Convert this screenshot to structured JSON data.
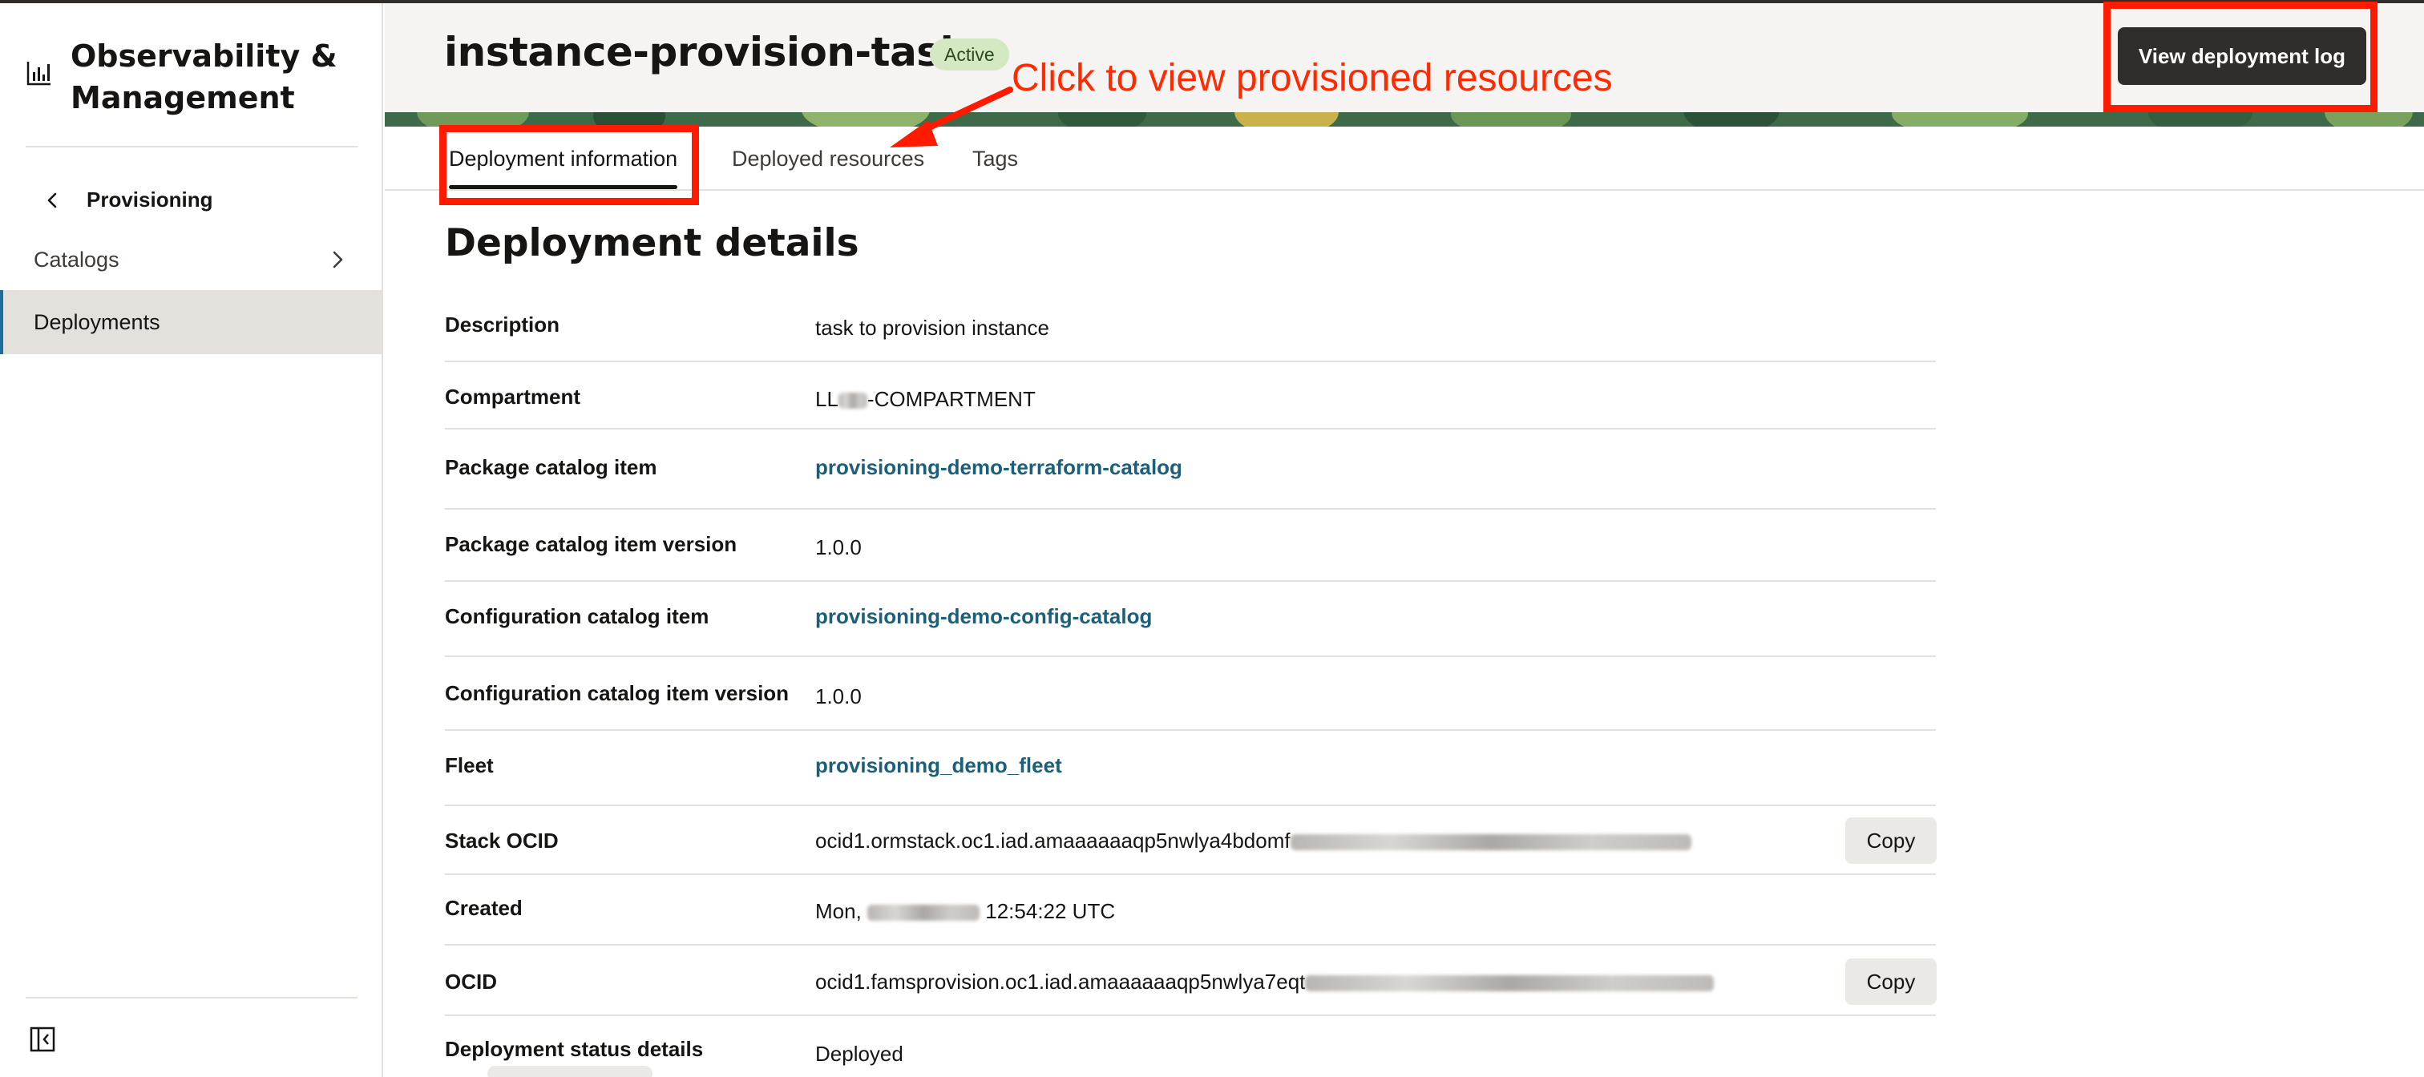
{
  "sidebar": {
    "title": "Observability & Management",
    "back_label": "Provisioning",
    "items": [
      {
        "label": "Catalogs"
      },
      {
        "label": "Deployments"
      }
    ]
  },
  "header": {
    "title": "instance-provision-task",
    "status": "Active",
    "primary_action": "View deployment log"
  },
  "annotation": {
    "text": "Click to view provisioned resources",
    "color": "#ff1a00"
  },
  "tabs": [
    {
      "label": "Deployment information",
      "active": true
    },
    {
      "label": "Deployed resources",
      "active": false
    },
    {
      "label": "Tags",
      "active": false
    }
  ],
  "details": {
    "title": "Deployment details",
    "rows": [
      {
        "label": "Description",
        "value": "task to provision instance"
      },
      {
        "label": "Compartment",
        "value_prefix": "LL",
        "value_suffix": "-COMPARTMENT"
      },
      {
        "label": "Package catalog item",
        "value": "provisioning-demo-terraform-catalog"
      },
      {
        "label": "Package catalog item version",
        "value": "1.0.0"
      },
      {
        "label": "Configuration catalog item",
        "value": "provisioning-demo-config-catalog"
      },
      {
        "label": "Configuration catalog item version",
        "value": "1.0.0"
      },
      {
        "label": "Fleet",
        "value": "provisioning_demo_fleet"
      },
      {
        "label": "Stack OCID",
        "value": "ocid1.ormstack.oc1.iad.amaaaaaaqp5nwlya4bdomf"
      },
      {
        "label": "Created",
        "value_prefix": "Mon, ",
        "value_suffix": " 12:54:22 UTC"
      },
      {
        "label": "OCID",
        "value": "ocid1.famsprovision.oc1.iad.amaaaaaaqp5nwlya7eqt"
      },
      {
        "label": "Deployment status details",
        "value": "Deployed"
      }
    ],
    "copy_label": "Copy"
  },
  "colors": {
    "link": "#1c5f7b",
    "primary_button": "#312d2a",
    "badge_bg": "#d4e8c4",
    "selected_nav": "#e4e1dd"
  }
}
